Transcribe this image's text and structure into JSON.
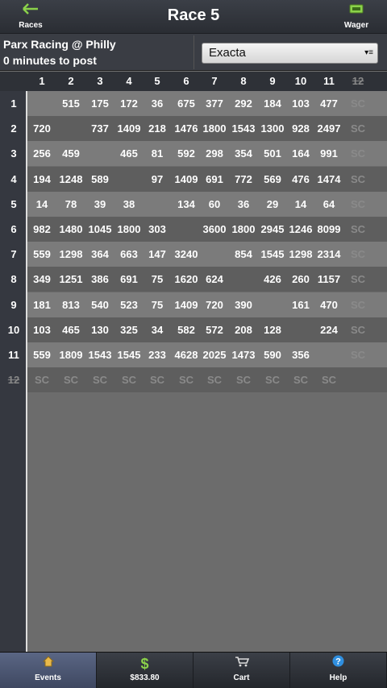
{
  "header": {
    "races_label": "Races",
    "title": "Race 5",
    "wager_label": "Wager"
  },
  "info": {
    "track": "Parx Racing @ Philly",
    "post_time": "0 minutes to post",
    "bet_type": "Exacta"
  },
  "grid": {
    "col_headers": [
      "1",
      "2",
      "3",
      "4",
      "5",
      "6",
      "7",
      "8",
      "9",
      "10",
      "11",
      "12"
    ],
    "scratched": [
      "12"
    ],
    "rows": [
      {
        "label": "1",
        "cells": [
          "",
          "515",
          "175",
          "172",
          "36",
          "675",
          "377",
          "292",
          "184",
          "103",
          "477",
          "SC"
        ]
      },
      {
        "label": "2",
        "cells": [
          "720",
          "",
          "737",
          "1409",
          "218",
          "1476",
          "1800",
          "1543",
          "1300",
          "928",
          "2497",
          "SC"
        ]
      },
      {
        "label": "3",
        "cells": [
          "256",
          "459",
          "",
          "465",
          "81",
          "592",
          "298",
          "354",
          "501",
          "164",
          "991",
          "SC"
        ]
      },
      {
        "label": "4",
        "cells": [
          "194",
          "1248",
          "589",
          "",
          "97",
          "1409",
          "691",
          "772",
          "569",
          "476",
          "1474",
          "SC"
        ]
      },
      {
        "label": "5",
        "cells": [
          "14",
          "78",
          "39",
          "38",
          "",
          "134",
          "60",
          "36",
          "29",
          "14",
          "64",
          "SC"
        ]
      },
      {
        "label": "6",
        "cells": [
          "982",
          "1480",
          "1045",
          "1800",
          "303",
          "",
          "3600",
          "1800",
          "2945",
          "1246",
          "8099",
          "SC"
        ]
      },
      {
        "label": "7",
        "cells": [
          "559",
          "1298",
          "364",
          "663",
          "147",
          "3240",
          "",
          "854",
          "1545",
          "1298",
          "2314",
          "SC"
        ]
      },
      {
        "label": "8",
        "cells": [
          "349",
          "1251",
          "386",
          "691",
          "75",
          "1620",
          "624",
          "",
          "426",
          "260",
          "1157",
          "SC"
        ]
      },
      {
        "label": "9",
        "cells": [
          "181",
          "813",
          "540",
          "523",
          "75",
          "1409",
          "720",
          "390",
          "",
          "161",
          "470",
          "SC"
        ]
      },
      {
        "label": "10",
        "cells": [
          "103",
          "465",
          "130",
          "325",
          "34",
          "582",
          "572",
          "208",
          "128",
          "",
          "224",
          "SC"
        ]
      },
      {
        "label": "11",
        "cells": [
          "559",
          "1809",
          "1543",
          "1545",
          "233",
          "4628",
          "2025",
          "1473",
          "590",
          "356",
          "",
          "SC"
        ]
      },
      {
        "label": "12",
        "cells": [
          "SC",
          "SC",
          "SC",
          "SC",
          "SC",
          "SC",
          "SC",
          "SC",
          "SC",
          "SC",
          "SC",
          ""
        ]
      }
    ]
  },
  "nav": {
    "tabs": [
      {
        "label": "Events",
        "icon": "home-icon",
        "active": true
      },
      {
        "label": "$833.80",
        "icon": "dollar-icon",
        "active": false
      },
      {
        "label": "Cart",
        "icon": "cart-icon",
        "active": false
      },
      {
        "label": "Help",
        "icon": "help-icon",
        "active": false
      }
    ]
  },
  "colors": {
    "accent_green": "#8bd24a",
    "help_blue": "#2f8fe0",
    "active_tab": "#4e5a78"
  }
}
